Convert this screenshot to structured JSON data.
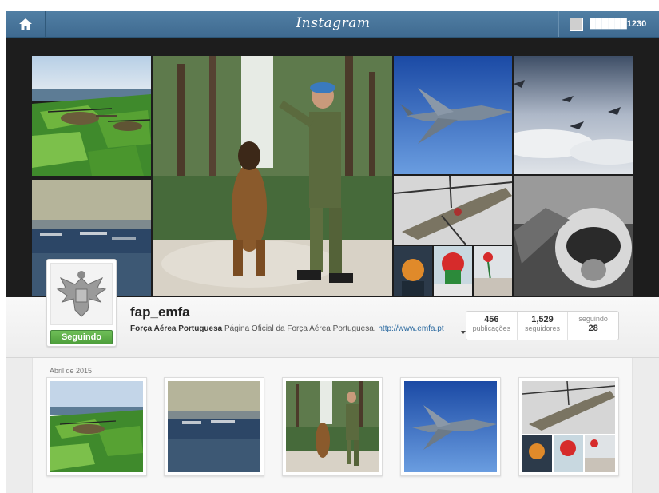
{
  "header": {
    "brand": "Instagram",
    "home_icon": "home-icon",
    "username": "██████1230"
  },
  "profile": {
    "username": "fap_emfa",
    "full_name": "Força Aérea Portuguesa",
    "bio": " Página Oficial da Força Aérea Portuguesa. ",
    "website": "http://www.emfa.pt",
    "follow_button": "Seguindo",
    "stats": [
      {
        "value": "456",
        "label": "publicações"
      },
      {
        "value": "1,529",
        "label": "seguidores"
      },
      {
        "value": "28",
        "label": "seguindo"
      }
    ]
  },
  "feed": {
    "section_label": "Abril de 2015"
  },
  "colors": {
    "nav_blue": "#517fa4",
    "follow_green": "#5aae45",
    "link_blue": "#2b6aa0"
  }
}
